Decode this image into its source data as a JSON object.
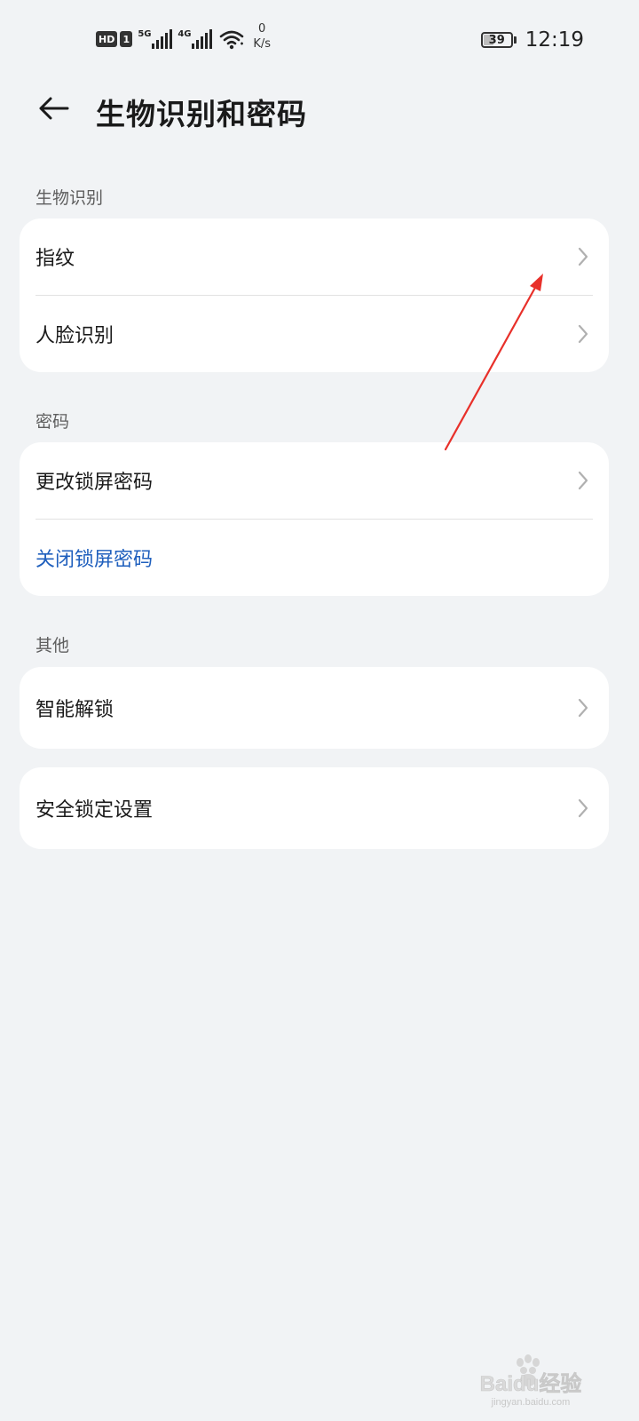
{
  "status_bar": {
    "hd": "HD",
    "sim": "1",
    "signal1_gen": "5G",
    "signal2_gen": "4G",
    "net_speed_value": "0",
    "net_speed_unit": "K/s",
    "battery": "39",
    "battery_level": 0.39,
    "time": "12:19",
    "icons": [
      "hd-icon",
      "signal-icon",
      "wifi-icon",
      "battery-icon"
    ]
  },
  "header": {
    "back_icon": "arrow-left-icon",
    "title": "生物识别和密码"
  },
  "sections": [
    {
      "label": "生物识别",
      "items": [
        {
          "label": "指纹",
          "chevron": true
        },
        {
          "label": "人脸识别",
          "chevron": true
        }
      ]
    },
    {
      "label": "密码",
      "items": [
        {
          "label": "更改锁屏密码",
          "chevron": true
        },
        {
          "label": "关闭锁屏密码",
          "chevron": false,
          "color": "#1f5fbd"
        }
      ]
    },
    {
      "label": "其他",
      "items": [
        {
          "label": "智能解锁",
          "chevron": true
        }
      ]
    },
    {
      "label": "",
      "items": [
        {
          "label": "安全锁定设置",
          "chevron": true
        }
      ]
    }
  ],
  "annotation": {
    "color": "#e8302a",
    "icon": "red-arrow-annotation"
  },
  "watermark": {
    "line1": "Baidu经验",
    "line2": "jingyan.baidu.com"
  },
  "colors": {
    "background": "#f1f3f5",
    "card": "#ffffff",
    "accent_blue": "#1f5fbd",
    "secondary_text": "#5e5e5e"
  }
}
